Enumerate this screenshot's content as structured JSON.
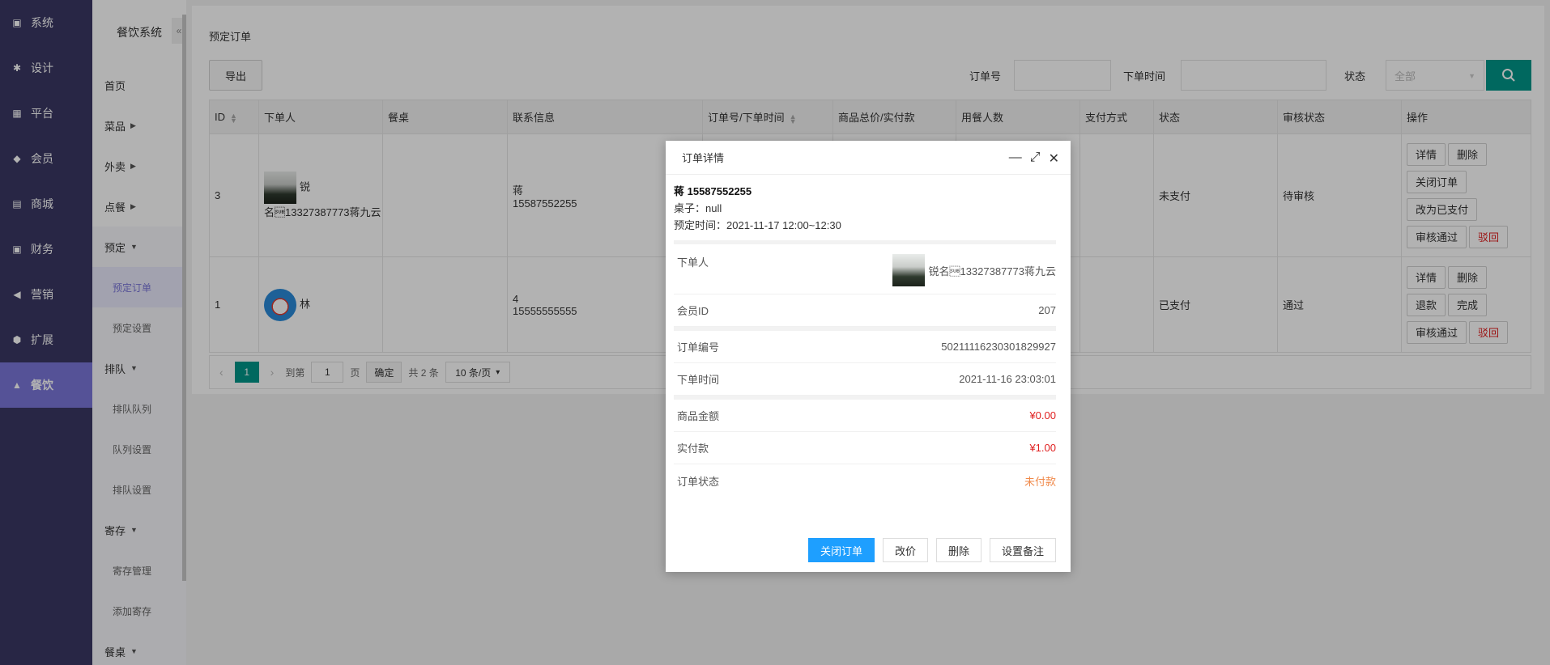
{
  "nav1": [
    {
      "label": "系统",
      "icon": "system-icon"
    },
    {
      "label": "设计",
      "icon": "puzzle-icon"
    },
    {
      "label": "平台",
      "icon": "grid-icon"
    },
    {
      "label": "会员",
      "icon": "diamond-icon"
    },
    {
      "label": "商城",
      "icon": "shop-icon"
    },
    {
      "label": "财务",
      "icon": "wallet-icon"
    },
    {
      "label": "营销",
      "icon": "megaphone-icon"
    },
    {
      "label": "扩展",
      "icon": "cube-icon"
    },
    {
      "label": "餐饮",
      "icon": "cloche-icon"
    }
  ],
  "nav2": {
    "title": "餐饮系统",
    "items": [
      {
        "label": "首页"
      },
      {
        "label": "菜品"
      },
      {
        "label": "外卖"
      },
      {
        "label": "点餐"
      },
      {
        "label": "预定"
      },
      {
        "label": "预定订单"
      },
      {
        "label": "预定设置"
      },
      {
        "label": "排队"
      },
      {
        "label": "排队队列"
      },
      {
        "label": "队列设置"
      },
      {
        "label": "排队设置"
      },
      {
        "label": "寄存"
      },
      {
        "label": "寄存管理"
      },
      {
        "label": "添加寄存"
      },
      {
        "label": "餐桌"
      }
    ]
  },
  "main": {
    "title": "预定订单",
    "export_label": "导出",
    "filters": {
      "order_no_label": "订单号",
      "time_label": "下单时间",
      "status_label": "状态",
      "status_value": "全部"
    },
    "columns": [
      "ID",
      "下单人",
      "餐桌",
      "联系信息",
      "订单号/下单时间",
      "商品总价/实付款",
      "用餐人数",
      "支付方式",
      "状态",
      "审核状态",
      "操作"
    ],
    "rows": [
      {
        "id": "3",
        "user": "锐名\u001a13327387773蒋九云",
        "contact_name": "蒋",
        "contact_phone": "15587552255",
        "status": "未支付",
        "audit": "待审核",
        "ops": [
          "详情",
          "删除",
          "关闭订单",
          "改为已支付",
          "审核通过",
          "驳回"
        ]
      },
      {
        "id": "1",
        "user": "林",
        "contact_name": "4",
        "contact_phone": "15555555555",
        "status": "已支付",
        "audit": "通过",
        "ops": [
          "详情",
          "删除",
          "退款",
          "完成",
          "审核通过",
          "驳回"
        ]
      }
    ],
    "pager": {
      "current": "1",
      "goto_label": "到第",
      "goto_value": "1",
      "page_unit": "页",
      "confirm": "确定",
      "total": "共 2 条",
      "per_page": "10 条/页"
    }
  },
  "modal": {
    "title": "订单详情",
    "name_phone": "蒋 15587552255",
    "table_line": "桌子：null",
    "reserve_time": "预定时间：2021-11-17 12:00~12:30",
    "fields": {
      "user_label": "下单人",
      "user_value": "锐名\u001a13327387773蒋九云",
      "member_id_label": "会员ID",
      "member_id_value": "207",
      "order_no_label": "订单编号",
      "order_no_value": "50211116230301829927",
      "order_time_label": "下单时间",
      "order_time_value": "2021-11-16 23:03:01",
      "goods_amount_label": "商品金额",
      "goods_amount_value": "¥0.00",
      "paid_label": "实付款",
      "paid_value": "¥1.00",
      "status_label": "订单状态",
      "status_value": "未付款"
    },
    "buttons": {
      "close_order": "关闭订单",
      "change_price": "改价",
      "delete": "删除",
      "set_note": "设置备注"
    }
  },
  "colors": {
    "nav_bg": "#3a3763",
    "nav_active": "#7a76d8",
    "primary_green": "#009688",
    "primary_blue": "#1e9fff",
    "danger": "#e02020"
  }
}
